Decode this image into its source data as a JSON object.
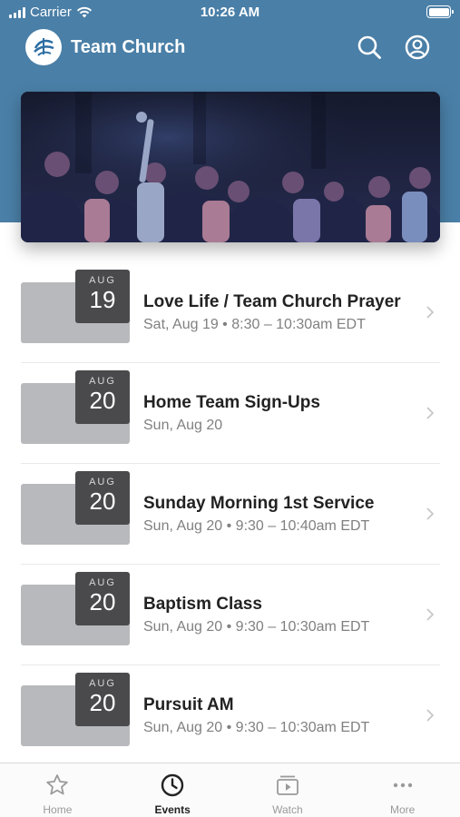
{
  "status_bar": {
    "carrier": "Carrier",
    "time": "10:26 AM"
  },
  "header": {
    "title": "Team Church"
  },
  "colors": {
    "brand": "#4a7fa7",
    "date_badge": "#4a4a4c",
    "thumbnail": "#b8b9bc"
  },
  "events": [
    {
      "month": "AUG",
      "day": "19",
      "title": "Love Life / Team Church Prayer",
      "subtitle": "Sat, Aug 19 • 8:30 – 10:30am EDT"
    },
    {
      "month": "AUG",
      "day": "20",
      "title": "Home Team Sign-Ups",
      "subtitle": "Sun, Aug 20"
    },
    {
      "month": "AUG",
      "day": "20",
      "title": "Sunday Morning 1st Service",
      "subtitle": "Sun, Aug 20 • 9:30 – 10:40am EDT"
    },
    {
      "month": "AUG",
      "day": "20",
      "title": "Baptism Class",
      "subtitle": "Sun, Aug 20 • 9:30 – 10:30am EDT"
    },
    {
      "month": "AUG",
      "day": "20",
      "title": "Pursuit AM",
      "subtitle": "Sun, Aug 20 • 9:30 – 10:30am EDT"
    }
  ],
  "tabs": [
    {
      "label": "Home",
      "icon": "star-icon",
      "active": false
    },
    {
      "label": "Events",
      "icon": "clock-icon",
      "active": true
    },
    {
      "label": "Watch",
      "icon": "play-icon",
      "active": false
    },
    {
      "label": "More",
      "icon": "ellipsis-icon",
      "active": false
    }
  ]
}
